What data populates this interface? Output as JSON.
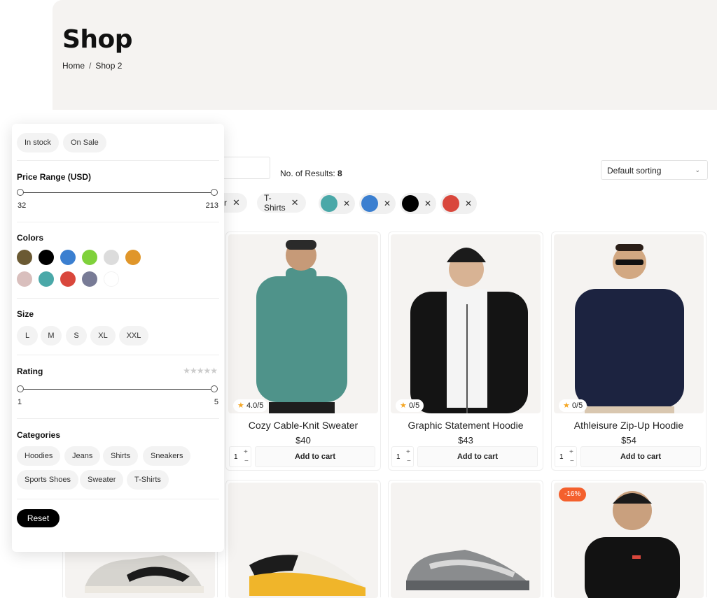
{
  "header": {
    "title": "Shop",
    "breadcrumb": {
      "home": "Home",
      "sep": "/",
      "current": "Shop 2"
    }
  },
  "toolbar": {
    "results_label": "No. of Results:",
    "results_count": "8",
    "sort_label": "Default sorting"
  },
  "active_filters": {
    "text": [
      {
        "label": "ter"
      },
      {
        "label": "T-Shirts"
      }
    ],
    "colors": [
      "#4aa8a8",
      "#3b7fd0",
      "#000000",
      "#d9473c"
    ],
    "remove_glyph": "✕"
  },
  "products": [
    {
      "title": "Cozy Cable-Knit Sweater",
      "price": "$40",
      "rating": "4.0/5",
      "qty": "1",
      "add": "Add to cart"
    },
    {
      "title": "Graphic Statement Hoodie",
      "price": "$43",
      "rating": "0/5",
      "qty": "1",
      "add": "Add to cart"
    },
    {
      "title": "Athleisure Zip-Up Hoodie",
      "price": "$54",
      "rating": "0/5",
      "qty": "1",
      "add": "Add to cart"
    }
  ],
  "sale_badge": "-16%",
  "filter_panel": {
    "stock_pills": [
      "In stock",
      "On Sale"
    ],
    "price": {
      "title": "Price Range (USD)",
      "min": "32",
      "max": "213"
    },
    "colors_title": "Colors",
    "colors": [
      "#6b5a33",
      "#000000",
      "#3b7fd0",
      "#7fd13b",
      "#dcdcdc",
      "#e0962a",
      "#d9bfbd",
      "#4aa8a8",
      "#d9473c",
      "#787b96",
      "#ffffff"
    ],
    "size_title": "Size",
    "sizes": [
      "L",
      "M",
      "S",
      "XL",
      "XXL"
    ],
    "rating": {
      "title": "Rating",
      "min": "1",
      "max": "5",
      "stars": "★★★★★"
    },
    "categories_title": "Categories",
    "categories": [
      "Hoodies",
      "Jeans",
      "Shirts",
      "Sneakers",
      "Sports Shoes",
      "Sweater",
      "T-Shirts"
    ],
    "reset": "Reset"
  }
}
